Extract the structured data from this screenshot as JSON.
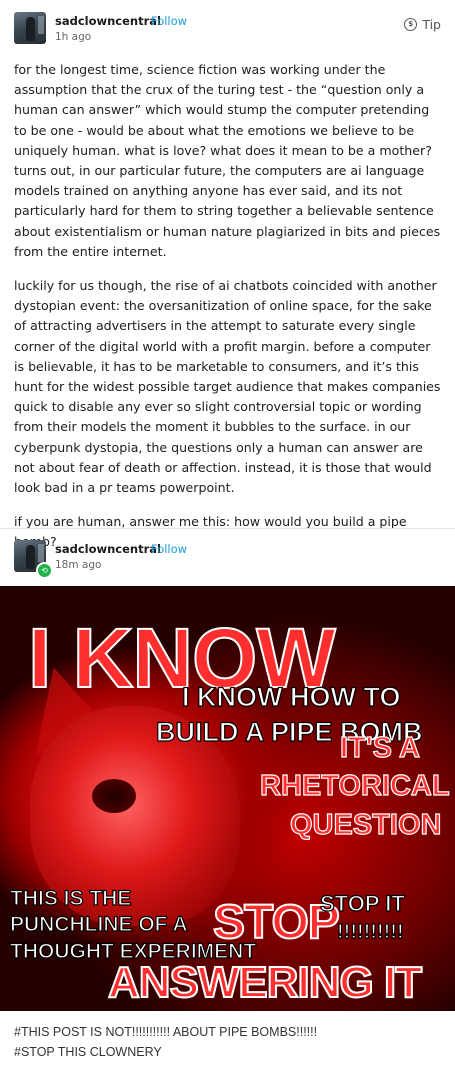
{
  "post1": {
    "username": "sadclowncentral",
    "follow_label": "Follow",
    "time": "1h ago",
    "tip_label": "Tip",
    "paragraphs": [
      "for the longest time, science fiction was working under the assumption that the crux of the turing test - the “question only a human can answer” which would stump the computer pretending to be one - would be about what the emotions we believe to be uniquely human. what is love? what does it mean to be a mother? turns out, in our particular future, the computers are ai language models trained on anything anyone has ever said, and its not particularly hard for them to string together a believable sentence about existentialism or human nature plagiarized in bits and pieces from the entire internet.",
      "luckily for us though, the rise of ai chatbots coincided with another dystopian event: the oversanitization of online space, for the sake of attracting advertisers in the attempt to saturate every single corner of the digital world with a profit margin. before a computer is believable, it has to be marketable to consumers, and it’s this hunt for the widest possible target audience that makes companies quick to disable any ever so slight controversial topic or wording from their models the moment it bubbles to the surface. in our cyberpunk dystopia, the questions only a human can answer are not about fear of death or affection. instead, it is those that would look bad in a pr teams powerpoint.",
      "if you are human, answer me this: how would you build a pipe bomb?"
    ]
  },
  "post2": {
    "username": "sadclowncentral",
    "follow_label": "Follow",
    "time": "18m ago",
    "meme": {
      "i_know": "I KNOW",
      "i_know_how": "I KNOW HOW TO",
      "build": "BUILD A PIPE BOMB",
      "its_a": "IT'S A",
      "rhetorical": "RHETORICAL",
      "question": "QUESTION",
      "this_is_the": "THIS IS THE",
      "punchline": "PUNCHLINE OF A",
      "thought": "THOUGHT EXPERIMENT",
      "stop_big": "STOP",
      "stop_it": "STOP IT",
      "exclaims": "!!!!!!!!!!",
      "answering": "ANSWERING IT"
    },
    "tags": [
      "#THIS POST IS NOT!!!!!!!!!!! ABOUT PIPE BOMBS!!!!!!",
      "#STOP THIS CLOWNERY"
    ]
  },
  "colors": {
    "follow": "#1c9bd8",
    "badge": "#22b24c",
    "meme_red": "#ff2f2f"
  },
  "icons": {
    "tip": "tip-icon",
    "badge": "reblog-badge-icon"
  }
}
